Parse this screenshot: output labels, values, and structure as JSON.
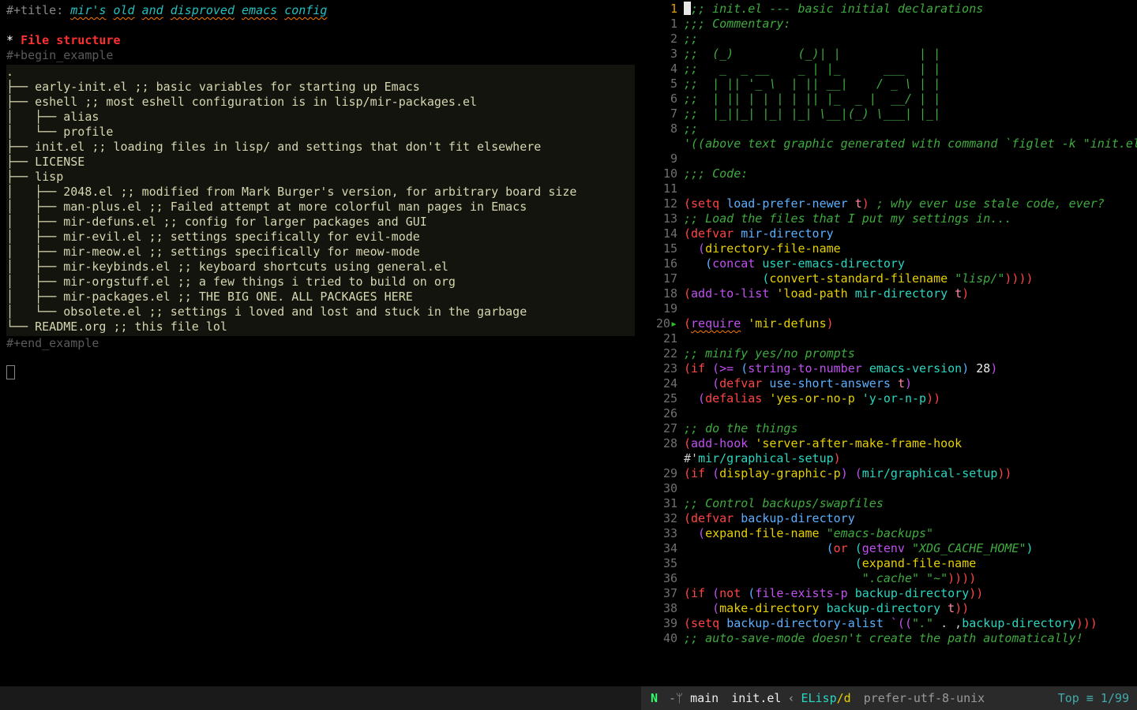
{
  "left": {
    "title_kw": "#+title:",
    "title_words": [
      "mir's",
      "old",
      "and",
      "disproved",
      "emacs",
      "config"
    ],
    "section_marker": "*",
    "section_label": "File structure",
    "begin": "#+begin_example",
    "end": "#+end_example",
    "tree": [
      ".",
      "├── early-init.el ;; basic variables for starting up Emacs",
      "├── eshell ;; most eshell configuration is in lisp/mir-packages.el",
      "│   ├── alias",
      "│   └── profile",
      "├── init.el ;; loading files in lisp/ and settings that don't fit elsewhere",
      "├── LICENSE",
      "├── lisp",
      "│   ├── 2048.el ;; modified from Mark Burger's version, for arbitrary board size",
      "│   ├── man-plus.el ;; Failed attempt at more colorful man pages in Emacs",
      "│   ├── mir-defuns.el ;; config for larger packages and GUI",
      "│   ├── mir-evil.el ;; settings specifically for evil-mode",
      "│   ├── mir-meow.el ;; settings specifically for meow-mode",
      "│   ├── mir-keybinds.el ;; keyboard shortcuts using general.el",
      "│   ├── mir-orgstuff.el ;; a few things i tried to build on org",
      "│   ├── mir-packages.el ;; THE BIG ONE. ALL PACKAGES HERE",
      "│   └── obsolete.el ;; settings i loved and lost and stuck in the garbage",
      "└── README.org ;; this file lol"
    ]
  },
  "right": {
    "header_ln": "1",
    "lines": [
      {
        "n": "",
        "cursor": true,
        "segs": [
          {
            "t": ";; init.el --- basic initial declarations",
            "c": "c-comment"
          }
        ]
      },
      {
        "n": "1",
        "segs": [
          {
            "t": ";;; Commentary:",
            "c": "c-comment"
          }
        ]
      },
      {
        "n": "2",
        "segs": [
          {
            "t": ";;",
            "c": "c-comment"
          }
        ]
      },
      {
        "n": "3",
        "segs": [
          {
            "t": ";;  (_)         (_)| |           | |",
            "c": "c-comment"
          }
        ]
      },
      {
        "n": "4",
        "segs": [
          {
            "t": ";;   _  _ __    _ | |_      ___  | |",
            "c": "c-comment"
          }
        ]
      },
      {
        "n": "5",
        "segs": [
          {
            "t": ";;  | || '_ \\  | || __|    / _ \\ | |",
            "c": "c-comment"
          }
        ]
      },
      {
        "n": "6",
        "segs": [
          {
            "t": ";;  | || | | | | || |_  _ |  __/ | |",
            "c": "c-comment"
          }
        ]
      },
      {
        "n": "7",
        "segs": [
          {
            "t": ";;  |_||_| |_| |_| \\__|(_) \\___| |_|",
            "c": "c-comment"
          }
        ]
      },
      {
        "n": "8",
        "segs": [
          {
            "t": ";;",
            "c": "c-comment"
          }
        ],
        "wrap": [
          {
            "t": "'((above text graphic generated with command `figlet -k \"init.el\"'))",
            "c": "c-comment"
          }
        ]
      },
      {
        "n": "9",
        "segs": []
      },
      {
        "n": "10",
        "segs": [
          {
            "t": ";;; Code:",
            "c": "c-comment"
          }
        ]
      },
      {
        "n": "11",
        "segs": []
      },
      {
        "n": "12",
        "segs": [
          {
            "t": "(",
            "c": "c-paren"
          },
          {
            "t": "setq ",
            "c": "c-keyword"
          },
          {
            "t": "load-prefer-newer ",
            "c": "c-defname"
          },
          {
            "t": "t",
            "c": "c-t"
          },
          {
            "t": ")",
            "c": "c-paren"
          },
          {
            "t": " ; why ever use stale code, ever?",
            "c": "c-comment"
          }
        ]
      },
      {
        "n": "13",
        "segs": [
          {
            "t": ";; Load the files that I put my settings in...",
            "c": "c-comment"
          }
        ]
      },
      {
        "n": "14",
        "segs": [
          {
            "t": "(",
            "c": "c-paren"
          },
          {
            "t": "defvar ",
            "c": "c-keyword"
          },
          {
            "t": "mir-directory",
            "c": "c-defname"
          }
        ]
      },
      {
        "n": "15",
        "segs": [
          {
            "t": "  (",
            "c": "c-paren2"
          },
          {
            "t": "directory-file-name",
            "c": "c-symY"
          }
        ]
      },
      {
        "n": "16",
        "segs": [
          {
            "t": "   (",
            "c": "c-paren3"
          },
          {
            "t": "concat ",
            "c": "c-fn"
          },
          {
            "t": "user-emacs-directory",
            "c": "c-sym"
          }
        ]
      },
      {
        "n": "17",
        "segs": [
          {
            "t": "           (",
            "c": "c-sym"
          },
          {
            "t": "convert-standard-filename ",
            "c": "c-symY"
          },
          {
            "t": "\"lisp/\"",
            "c": "c-str"
          },
          {
            "t": "))))",
            "c": "c-paren"
          }
        ]
      },
      {
        "n": "18",
        "segs": [
          {
            "t": "(",
            "c": "c-paren"
          },
          {
            "t": "add-to-list ",
            "c": "c-fn"
          },
          {
            "t": "'load-path ",
            "c": "c-symY"
          },
          {
            "t": "mir-directory ",
            "c": "c-sym"
          },
          {
            "t": "t",
            "c": "c-t"
          },
          {
            "t": ")",
            "c": "c-paren"
          }
        ]
      },
      {
        "n": "19",
        "segs": []
      },
      {
        "n": "20",
        "arrow": true,
        "segs": [
          {
            "t": "(",
            "c": "c-paren"
          },
          {
            "t": "require",
            "c": "c-fn und"
          },
          {
            "t": " 'mir-defuns",
            "c": "c-symY"
          },
          {
            "t": ")",
            "c": "c-paren"
          }
        ]
      },
      {
        "n": "21",
        "segs": []
      },
      {
        "n": "22",
        "segs": [
          {
            "t": ";; minify yes/no prompts",
            "c": "c-comment"
          }
        ]
      },
      {
        "n": "23",
        "segs": [
          {
            "t": "(",
            "c": "c-paren"
          },
          {
            "t": "if ",
            "c": "c-keyword"
          },
          {
            "t": "(",
            "c": "c-paren2"
          },
          {
            "t": ">= ",
            "c": "c-fn"
          },
          {
            "t": "(",
            "c": "c-paren3"
          },
          {
            "t": "string-to-number ",
            "c": "c-fn"
          },
          {
            "t": "emacs-version",
            "c": "c-sym"
          },
          {
            "t": ")",
            "c": "c-paren3"
          },
          {
            "t": " 28",
            "c": "c-num"
          },
          {
            "t": ")",
            "c": "c-paren2"
          }
        ]
      },
      {
        "n": "24",
        "segs": [
          {
            "t": "    (",
            "c": "c-paren2"
          },
          {
            "t": "defvar ",
            "c": "c-keyword"
          },
          {
            "t": "use-short-answers ",
            "c": "c-defname"
          },
          {
            "t": "t",
            "c": "c-t"
          },
          {
            "t": ")",
            "c": "c-paren2"
          }
        ]
      },
      {
        "n": "25",
        "segs": [
          {
            "t": "  (",
            "c": "c-paren2"
          },
          {
            "t": "defalias ",
            "c": "c-keyword"
          },
          {
            "t": "'yes-or-no-p ",
            "c": "c-symY"
          },
          {
            "t": "'y-or-n-p",
            "c": "c-sym"
          },
          {
            "t": "))",
            "c": "c-paren"
          }
        ]
      },
      {
        "n": "26",
        "segs": []
      },
      {
        "n": "27",
        "segs": [
          {
            "t": ";; do the things",
            "c": "c-comment"
          }
        ]
      },
      {
        "n": "28",
        "segs": [
          {
            "t": "(",
            "c": "c-paren"
          },
          {
            "t": "add-hook ",
            "c": "c-fn"
          },
          {
            "t": "'server-after-make-frame-hook",
            "c": "c-symY"
          }
        ],
        "wrap": [
          {
            "t": "#'",
            "c": ""
          },
          {
            "t": "mir/graphical-setup",
            "c": "c-sym"
          },
          {
            "t": ")",
            "c": "c-paren"
          }
        ]
      },
      {
        "n": "29",
        "segs": [
          {
            "t": "(",
            "c": "c-paren"
          },
          {
            "t": "if ",
            "c": "c-keyword"
          },
          {
            "t": "(",
            "c": "c-paren2"
          },
          {
            "t": "display-graphic-p",
            "c": "c-symY"
          },
          {
            "t": ") (",
            "c": "c-paren2"
          },
          {
            "t": "mir/graphical-setup",
            "c": "c-sym"
          },
          {
            "t": "))",
            "c": "c-paren"
          }
        ]
      },
      {
        "n": "30",
        "segs": []
      },
      {
        "n": "31",
        "segs": [
          {
            "t": ";; Control backups/swapfiles",
            "c": "c-comment"
          }
        ]
      },
      {
        "n": "32",
        "segs": [
          {
            "t": "(",
            "c": "c-paren"
          },
          {
            "t": "defvar ",
            "c": "c-keyword"
          },
          {
            "t": "backup-directory",
            "c": "c-defname"
          }
        ]
      },
      {
        "n": "33",
        "segs": [
          {
            "t": "  (",
            "c": "c-paren2"
          },
          {
            "t": "expand-file-name ",
            "c": "c-symY"
          },
          {
            "t": "\"emacs-backups\"",
            "c": "c-str"
          }
        ]
      },
      {
        "n": "34",
        "segs": [
          {
            "t": "                    (",
            "c": "c-paren3"
          },
          {
            "t": "or ",
            "c": "c-keyword"
          },
          {
            "t": "(",
            "c": "c-sym"
          },
          {
            "t": "getenv ",
            "c": "c-fn"
          },
          {
            "t": "\"XDG_CACHE_HOME\"",
            "c": "c-str"
          },
          {
            "t": ")",
            "c": "c-sym"
          }
        ]
      },
      {
        "n": "35",
        "segs": [
          {
            "t": "                        (",
            "c": "c-sym"
          },
          {
            "t": "expand-file-name",
            "c": "c-symY"
          }
        ]
      },
      {
        "n": "36",
        "segs": [
          {
            "t": "                         \".cache\" \"~\"",
            "c": "c-str"
          },
          {
            "t": "))))",
            "c": "c-paren"
          }
        ]
      },
      {
        "n": "37",
        "segs": [
          {
            "t": "(",
            "c": "c-paren"
          },
          {
            "t": "if ",
            "c": "c-keyword"
          },
          {
            "t": "(",
            "c": "c-paren2"
          },
          {
            "t": "not ",
            "c": "c-keyword"
          },
          {
            "t": "(",
            "c": "c-paren3"
          },
          {
            "t": "file-exists-p ",
            "c": "c-fn"
          },
          {
            "t": "backup-directory",
            "c": "c-sym"
          },
          {
            "t": "))",
            "c": "c-paren"
          }
        ]
      },
      {
        "n": "38",
        "segs": [
          {
            "t": "    (",
            "c": "c-paren2"
          },
          {
            "t": "make-directory ",
            "c": "c-symY"
          },
          {
            "t": "backup-directory ",
            "c": "c-sym"
          },
          {
            "t": "t",
            "c": "c-t"
          },
          {
            "t": "))",
            "c": "c-paren"
          }
        ]
      },
      {
        "n": "39",
        "segs": [
          {
            "t": "(",
            "c": "c-paren"
          },
          {
            "t": "setq ",
            "c": "c-keyword"
          },
          {
            "t": "backup-directory-alist ",
            "c": "c-defname"
          },
          {
            "t": "`((",
            "c": "c-paren2"
          },
          {
            "t": "\".\"",
            "c": "c-str"
          },
          {
            "t": " . ,",
            "c": ""
          },
          {
            "t": "backup-directory",
            "c": "c-sym"
          },
          {
            "t": ")))",
            "c": "c-paren"
          }
        ]
      },
      {
        "n": "40",
        "segs": [
          {
            "t": ";; auto-save-mode doesn't create the path automatically!",
            "c": "c-comment"
          }
        ]
      }
    ]
  },
  "modeline": {
    "state": "N",
    "branch_icon": "-ᛘ",
    "branch": "main",
    "file": "init.el",
    "sep": "‹",
    "mode": "ELisp",
    "mode_suffix": "/d",
    "encoding": "prefer-utf-8-unix",
    "pos": "Top ≡ 1/99"
  }
}
